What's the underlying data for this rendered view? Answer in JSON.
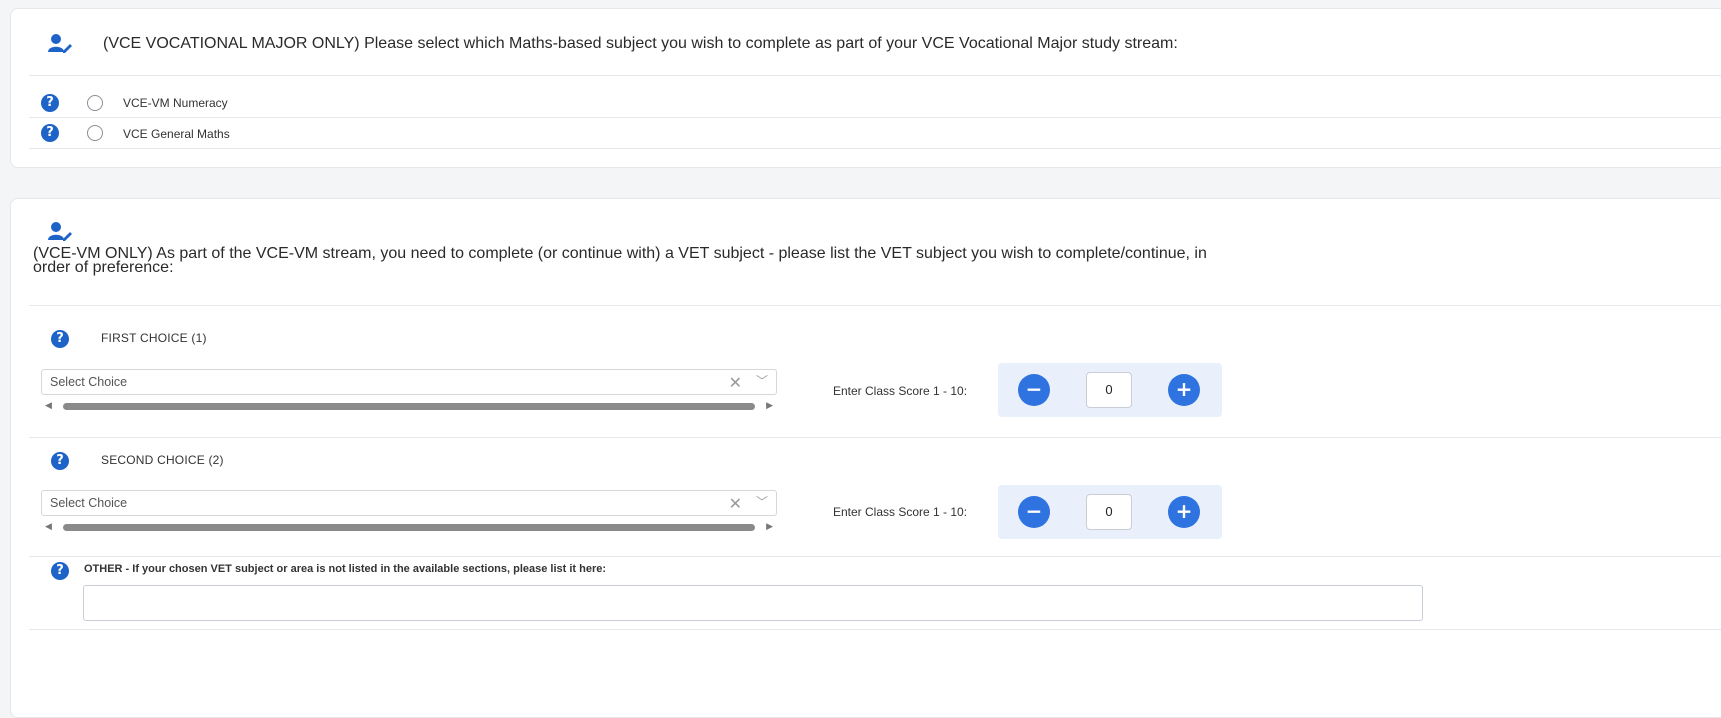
{
  "section1": {
    "heading": "(VCE VOCATIONAL MAJOR ONLY) Please select which Maths-based subject you wish to complete as part of your VCE Vocational Major study stream:",
    "options": [
      {
        "label": "VCE-VM Numeracy",
        "selected": false
      },
      {
        "label": "VCE General Maths",
        "selected": false
      }
    ]
  },
  "section2": {
    "heading_line1": "(VCE-VM ONLY) As part of the VCE-VM stream, you need to complete (or continue with) a VET subject - please list the VET subject you wish to complete/continue, in",
    "heading_line2": "order of preference:",
    "choices": [
      {
        "label": "FIRST CHOICE (1)",
        "placeholder": "Select Choice",
        "score_label": "Enter Class Score 1 - 10:",
        "score": "0"
      },
      {
        "label": "SECOND CHOICE (2)",
        "placeholder": "Select Choice",
        "score_label": "Enter Class Score 1 - 10:",
        "score": "0"
      }
    ],
    "other_label": "OTHER - If your chosen VET subject or area is not listed in the available sections, please list it here:",
    "other_value": ""
  },
  "icons": {
    "user": "user-edit-icon",
    "help": "question-circle-icon",
    "clear": "clear-x-icon",
    "dropdown": "chevron-down-icon",
    "minus": "minus-icon",
    "plus": "plus-icon"
  },
  "colors": {
    "accent": "#2f73e0",
    "help_icon": "#1e63c8",
    "user_icon": "#1e63c8",
    "stepper_bg": "#e9f0fb"
  }
}
